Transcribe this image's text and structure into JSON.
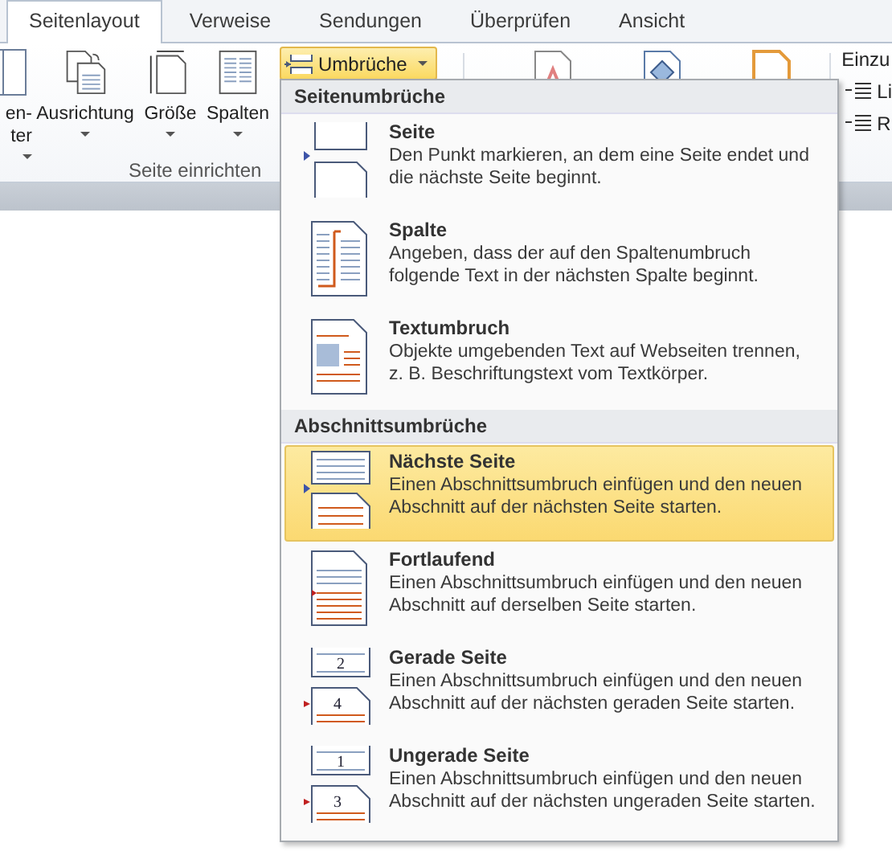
{
  "tabs": [
    {
      "label": "Seitenlayout",
      "selected": true
    },
    {
      "label": "Verweise",
      "selected": false
    },
    {
      "label": "Sendungen",
      "selected": false
    },
    {
      "label": "Überprüfen",
      "selected": false
    },
    {
      "label": "Ansicht",
      "selected": false
    }
  ],
  "ribbon": {
    "group_label": "Seite einrichten",
    "left_buttons": [
      {
        "kind": "cut",
        "lines": [
          "en-",
          "ter"
        ],
        "dropdown": true
      },
      {
        "kind": "orientation",
        "lines": [
          "Ausrichtung"
        ],
        "dropdown": true
      },
      {
        "kind": "size",
        "lines": [
          "Größe"
        ],
        "dropdown": true
      },
      {
        "kind": "columns",
        "lines": [
          "Spalten"
        ],
        "dropdown": true
      }
    ],
    "breaks_button": {
      "label": "Umbrüche",
      "active": true
    },
    "right_group": {
      "title": "Einzu",
      "items": [
        "Li",
        "R"
      ]
    }
  },
  "menu": {
    "sections": [
      {
        "title": "Seitenumbrüche",
        "items": [
          {
            "kind": "page",
            "title": "Seite",
            "lines": [
              "Den Punkt markieren, an dem eine Seite endet und",
              "die nächste Seite beginnt."
            ],
            "selected": false
          },
          {
            "kind": "column",
            "title": "Spalte",
            "lines": [
              "Angeben, dass der auf den Spaltenumbruch",
              "folgende Text in der nächsten Spalte beginnt."
            ],
            "selected": false
          },
          {
            "kind": "textwrap",
            "title": "Textumbruch",
            "lines": [
              "Objekte umgebenden Text auf Webseiten trennen,",
              "z. B. Beschriftungstext vom Textkörper."
            ],
            "selected": false
          }
        ]
      },
      {
        "title": "Abschnittsumbrüche",
        "items": [
          {
            "kind": "next_page",
            "title": "Nächste Seite",
            "lines": [
              "Einen Abschnittsumbruch einfügen und den neuen",
              "Abschnitt auf der nächsten Seite starten."
            ],
            "selected": true
          },
          {
            "kind": "continuous",
            "title": "Fortlaufend",
            "lines": [
              "Einen Abschnittsumbruch einfügen und den neuen",
              "Abschnitt auf derselben Seite starten."
            ],
            "selected": false
          },
          {
            "kind": "even_page",
            "title": "Gerade Seite",
            "numbers": [
              "2",
              "4"
            ],
            "lines": [
              "Einen Abschnittsumbruch einfügen und den neuen",
              "Abschnitt auf der nächsten geraden Seite starten."
            ],
            "selected": false
          },
          {
            "kind": "odd_page",
            "title": "Ungerade Seite",
            "numbers": [
              "1",
              "3"
            ],
            "lines": [
              "Einen Abschnittsumbruch einfügen und den neuen",
              "Abschnitt auf der nächsten ungeraden Seite starten."
            ],
            "selected": false
          }
        ]
      }
    ]
  }
}
